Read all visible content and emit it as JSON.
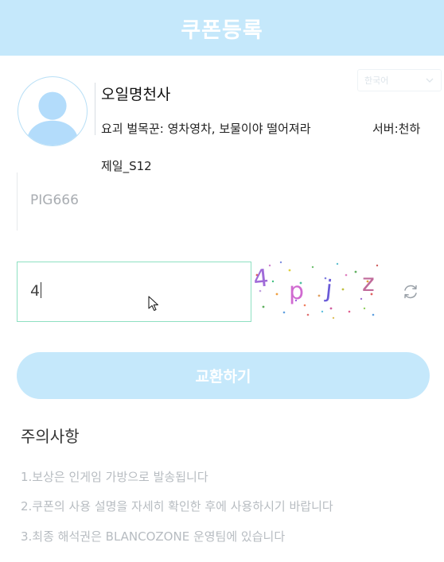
{
  "header": {
    "title": "쿠폰등록"
  },
  "language_select": {
    "value": "한국어"
  },
  "profile": {
    "nickname": "오일명천사",
    "character_text": "요괴 벌목꾼: 영차영차, 보물이야 떨어져라",
    "server_text": "서버:천하",
    "server_text_cont": "제일_S12"
  },
  "coupon": {
    "placeholder": "PIG666"
  },
  "captcha": {
    "input_value": "4",
    "chars": [
      "4",
      "p",
      "j",
      "z"
    ],
    "char_colors": [
      "#a06bd8",
      "#d06ad0",
      "#6a5bd8",
      "#c06a9a"
    ]
  },
  "exchange_button": {
    "label": "교환하기"
  },
  "notice": {
    "title": "주의사항",
    "items": [
      "1.보상은 인게임 가방으로 발송됩니다",
      "2.쿠폰의 사용 설명을 자세히 확인한 후에 사용하시기 바랍니다",
      "3.최종 해석권은 BLANCOZONE 운영팀에 있습니다"
    ]
  },
  "colors": {
    "header_bg": "#c5e8fb",
    "button_bg": "#c5e8fb",
    "input_focus_border": "#8ee0c2",
    "avatar_fill": "#b3dcfb"
  }
}
